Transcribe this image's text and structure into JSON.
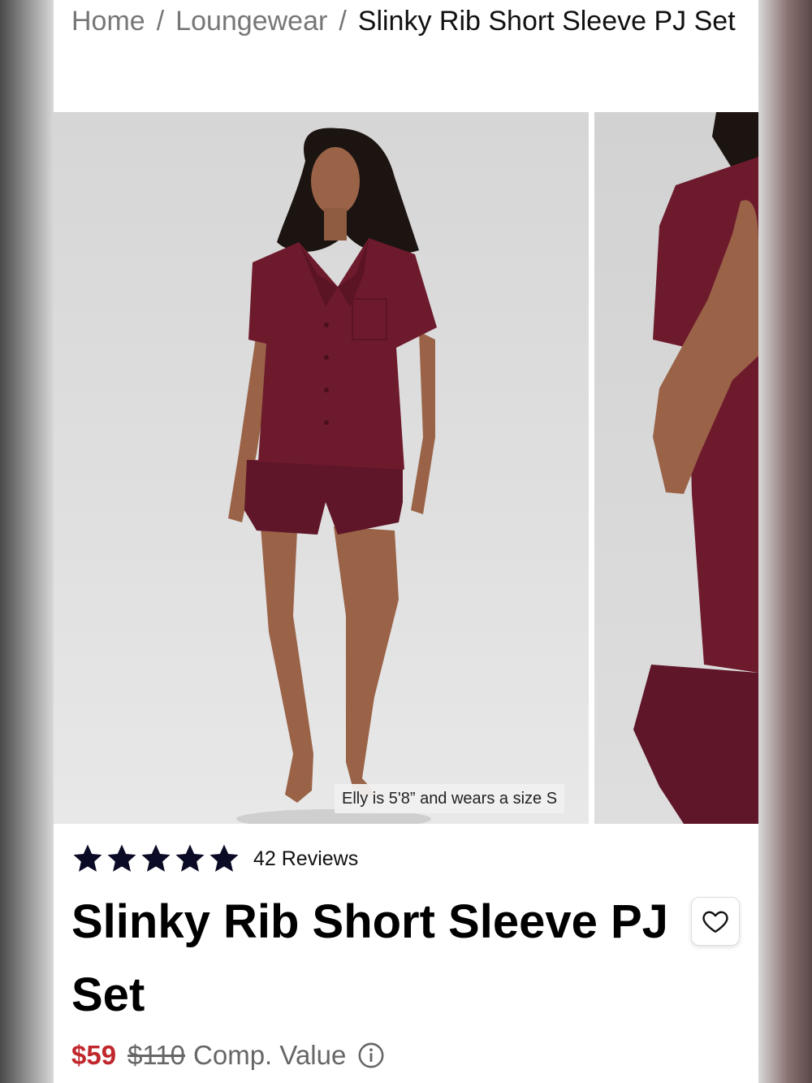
{
  "breadcrumb": {
    "home": "Home",
    "separator": "/",
    "category": "Loungewear",
    "current": "Slinky Rib Short Sleeve PJ Set"
  },
  "gallery": {
    "caption": "Elly is 5'8” and wears a size S",
    "colors": {
      "garment": "#6e1a2d",
      "skin": "#9a6348",
      "hair": "#1c1410"
    }
  },
  "rating": {
    "stars": 5,
    "reviews_label": "42 Reviews"
  },
  "product": {
    "title": "Slinky Rib Short Sleeve PJ Set",
    "price": "$59",
    "original_price": "$110",
    "comp_label": "Comp. Value",
    "price_color": "#c0282d"
  },
  "icons": {
    "star": "star-icon",
    "wishlist": "heart-icon",
    "info": "info-icon"
  }
}
